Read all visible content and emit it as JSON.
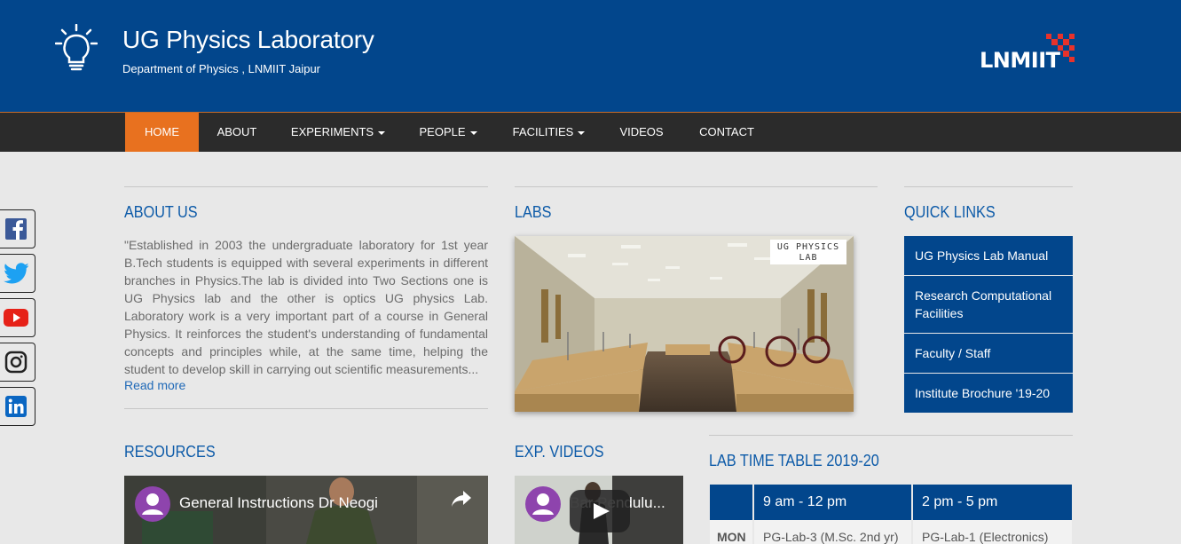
{
  "header": {
    "title": "UG Physics Laboratory",
    "subtitle": "Department of Physics , LNMIIT Jaipur",
    "brand": "LNMIIT",
    "brand_accent": "#e8322b",
    "bg_color": "#02468c"
  },
  "nav": {
    "items": [
      {
        "label": "HOME",
        "active": true
      },
      {
        "label": "ABOUT"
      },
      {
        "label": "EXPERIMENTS",
        "dropdown": true
      },
      {
        "label": "PEOPLE",
        "dropdown": true
      },
      {
        "label": "FACILITIES",
        "dropdown": true
      },
      {
        "label": "VIDEOS"
      },
      {
        "label": "CONTACT"
      }
    ],
    "active_color": "#e8711f"
  },
  "social": [
    "facebook-icon",
    "twitter-icon",
    "youtube-icon",
    "instagram-icon",
    "linkedin-icon"
  ],
  "about": {
    "title": "ABOUT US",
    "text": "\"Established in 2003 the undergraduate laboratory for 1st year B.Tech students is equipped with several experiments in different branches in Physics.The lab is divided into Two Sections one is UG Physics lab and the other is optics UG physics Lab. Laboratory work is a very important part of a course in General Physics. It reinforces the student's understanding of fundamental concepts and principles while, at the same time, helping the student to develop skill in carrying out scientific measurements...",
    "read_more": "Read more"
  },
  "labs": {
    "title": "LABS",
    "badge_line1": "UG PHYSICS",
    "badge_line2": "LAB"
  },
  "quick_links": {
    "title": "QUICK LINKS",
    "items": [
      "UG Physics Lab Manual",
      "Research Computational Facilities",
      "Faculty / Staff",
      "Institute Brochure '19-20"
    ]
  },
  "resources": {
    "title": "RESOURCES",
    "video_title": "General Instructions Dr Neogi"
  },
  "exp_videos": {
    "title": "EXP. VIDEOS",
    "video_title": "Bar Pendulu..."
  },
  "timetable": {
    "title": "LAB TIME TABLE 2019-20",
    "headers": [
      "",
      "9 am - 12 pm",
      "2 pm - 5 pm"
    ],
    "rows": [
      [
        "MON",
        "PG-Lab-3 (M.Sc. 2nd yr)",
        "PG-Lab-1 (Electronics)"
      ]
    ]
  }
}
